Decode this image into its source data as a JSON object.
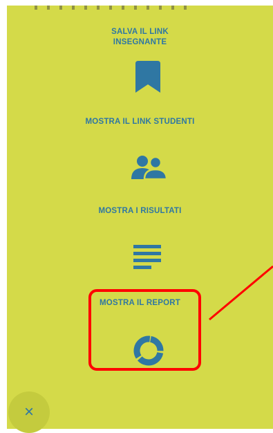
{
  "menu": {
    "items": [
      {
        "label_line1": "SALVA IL LINK",
        "label_line2": "INSEGNANTE",
        "icon": "bookmark-icon"
      },
      {
        "label": "MOSTRA IL LINK STUDENTI",
        "icon": "users-icon"
      },
      {
        "label": "MOSTRA I RISULTATI",
        "icon": "text-lines-icon"
      },
      {
        "label": "MOSTRA IL REPORT",
        "icon": "donut-chart-icon"
      }
    ],
    "close_label": "×"
  },
  "colors": {
    "background": "#d4da49",
    "accent": "#2f77a3",
    "annotation": "#ff0000"
  }
}
